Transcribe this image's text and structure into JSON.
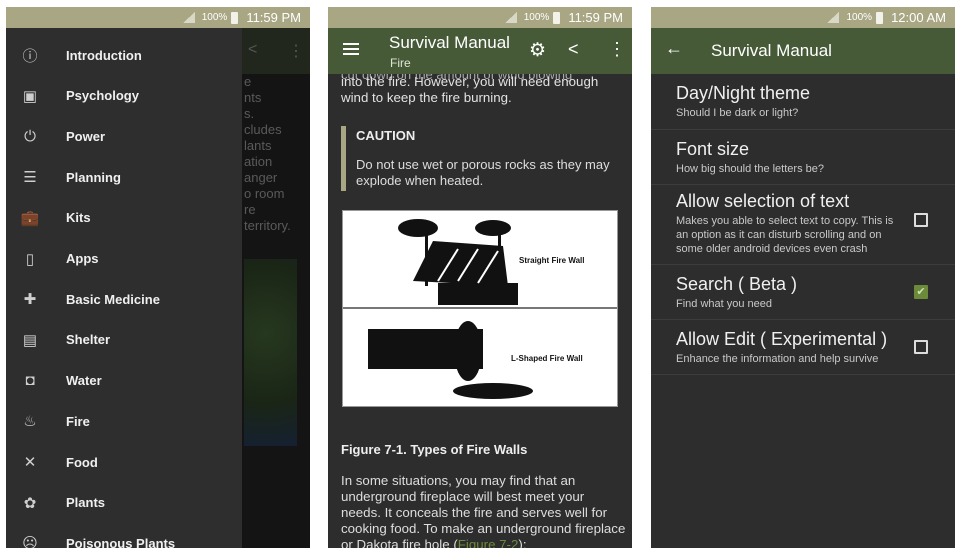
{
  "screen1": {
    "status": {
      "battery": "100%",
      "time": "11:59 PM"
    },
    "background_text": "e\nnts\ns.\ncludes\nlants\nation\nanger\no room\nre\nterritory.",
    "drawer": [
      {
        "icon": "info-icon",
        "glyph": "ⓘ",
        "label": "Introduction"
      },
      {
        "icon": "contact-card-icon",
        "glyph": "▣",
        "label": "Psychology"
      },
      {
        "icon": "power-plug-icon",
        "glyph": "⏻",
        "label": "Power"
      },
      {
        "icon": "list-icon",
        "glyph": "☰",
        "label": "Planning"
      },
      {
        "icon": "briefcase-icon",
        "glyph": "💼",
        "label": "Kits"
      },
      {
        "icon": "phone-icon",
        "glyph": "▯",
        "label": "Apps"
      },
      {
        "icon": "bandage-icon",
        "glyph": "✚",
        "label": "Basic Medicine"
      },
      {
        "icon": "store-icon",
        "glyph": "▤",
        "label": "Shelter"
      },
      {
        "icon": "water-glass-icon",
        "glyph": "◘",
        "label": "Water"
      },
      {
        "icon": "fire-icon",
        "glyph": "♨",
        "label": "Fire"
      },
      {
        "icon": "utensils-icon",
        "glyph": "✕",
        "label": "Food"
      },
      {
        "icon": "flower-icon",
        "glyph": "✿",
        "label": "Plants"
      },
      {
        "icon": "sad-face-icon",
        "glyph": "☹",
        "label": "Poisonous Plants"
      }
    ]
  },
  "screen2": {
    "status": {
      "battery": "100%",
      "time": "11:59 PM"
    },
    "title": "Survival Manual",
    "subtitle": "Fire",
    "icons": {
      "menu": "☰",
      "gear": "⚙",
      "share": "<",
      "more": "⋮"
    },
    "cut_text": "cut down on the amount of wind blowing",
    "text1": "into the fire. However, you will need enough wind to keep the fire burning.",
    "caution_title": "CAUTION",
    "caution_text": "Do not use wet or porous rocks as they may explode when heated.",
    "figure_labels": [
      "Straight Fire Wall",
      "L-Shaped Fire Wall"
    ],
    "figure_caption": "Figure 7-1. Types of Fire Walls",
    "para": "In some situations, you may find that an underground fireplace will best meet your needs. It conceals the fire and serves well for cooking food. To make an underground fireplace or Dakota fire hole (",
    "para_link": "Figure 7-2",
    "para_end": "):"
  },
  "screen3": {
    "status": {
      "battery": "100%",
      "time": "12:00 AM"
    },
    "title": "Survival Manual",
    "back": "←",
    "prefs": [
      {
        "title": "Day/Night theme",
        "summary": "Should I be dark or light?",
        "checkbox": null
      },
      {
        "title": "Font size",
        "summary": "How big should the letters be?",
        "checkbox": null
      },
      {
        "title": "Allow selection of text",
        "summary": "Makes you able to select text to copy. This is an option as it can disturb scrolling and on some older android devices even crash",
        "checkbox": false
      },
      {
        "title": "Search ( Beta )",
        "summary": "Find what you need",
        "checkbox": true
      },
      {
        "title": "Allow Edit ( Experimental )",
        "summary": "Enhance the information and help survive",
        "checkbox": false
      }
    ],
    "check_glyph": "✔"
  }
}
